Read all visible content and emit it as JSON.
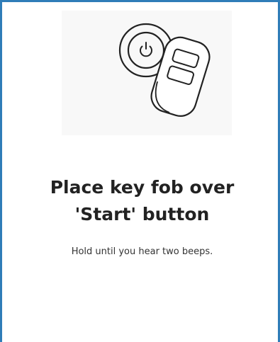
{
  "instruction": {
    "title": "Place key fob over\n'Start' button",
    "subtitle": "Hold until you hear two beeps."
  },
  "illustration": {
    "start_button_icon": "power-icon",
    "key_fob_icon": "key-fob-icon"
  },
  "colors": {
    "frame_border": "#2f7db8",
    "text": "#222222",
    "illustration_background": "#f8f8f8"
  }
}
